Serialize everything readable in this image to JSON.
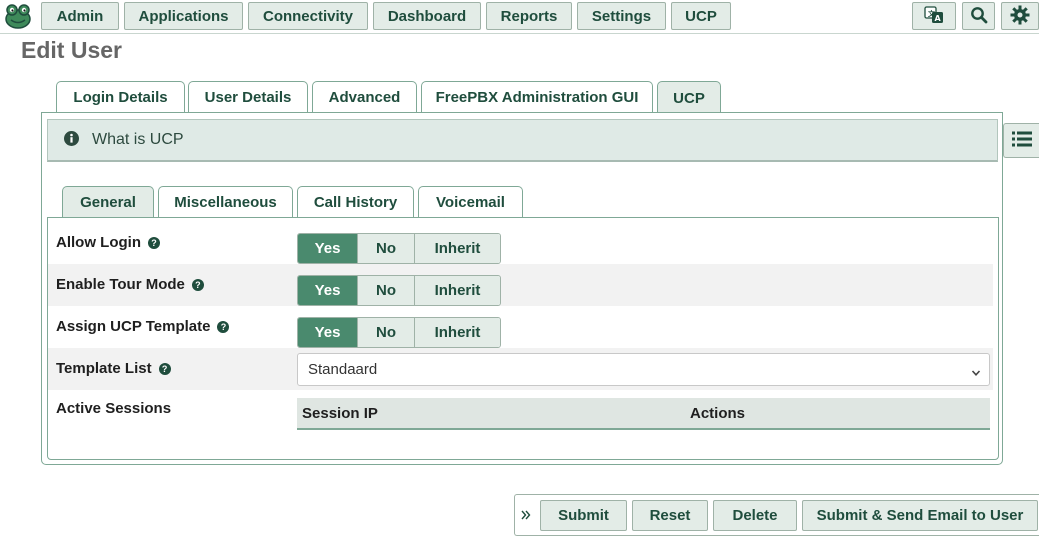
{
  "nav": {
    "items": [
      "Admin",
      "Applications",
      "Connectivity",
      "Dashboard",
      "Reports",
      "Settings",
      "UCP"
    ],
    "icons": [
      "translate-icon",
      "search-icon",
      "gear-icon"
    ]
  },
  "page": {
    "title": "Edit User"
  },
  "tabs": [
    "Login Details",
    "User Details",
    "Advanced",
    "FreePBX Administration GUI",
    "UCP"
  ],
  "active_tab": "UCP",
  "info": {
    "title": "What is UCP"
  },
  "inner_tabs": [
    "General",
    "Miscellaneous",
    "Call History",
    "Voicemail"
  ],
  "active_inner_tab": "General",
  "form": {
    "allow_login": {
      "label": "Allow Login",
      "options": [
        "Yes",
        "No",
        "Inherit"
      ],
      "selected": "Yes"
    },
    "enable_tour": {
      "label": "Enable Tour Mode",
      "options": [
        "Yes",
        "No",
        "Inherit"
      ],
      "selected": "Yes"
    },
    "assign_template": {
      "label": "Assign UCP Template",
      "options": [
        "Yes",
        "No",
        "Inherit"
      ],
      "selected": "Yes"
    },
    "template_list": {
      "label": "Template List",
      "value": "Standaard"
    },
    "active_sessions": {
      "label": "Active Sessions",
      "columns": [
        "Session IP",
        "Actions"
      ]
    }
  },
  "actions": [
    "Submit",
    "Reset",
    "Delete",
    "Submit & Send Email to User"
  ],
  "colors": {
    "accent": "#4a8a6e",
    "button_bg": "#e3ece7",
    "text_dark": "#1f4d3d"
  }
}
